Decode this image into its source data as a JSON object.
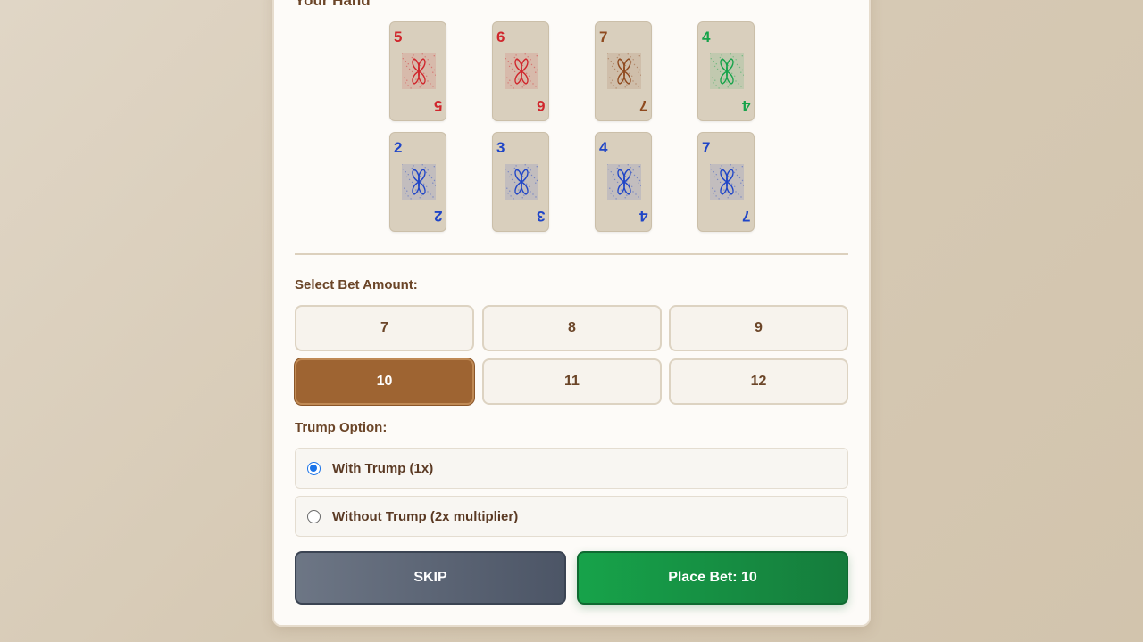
{
  "hand": {
    "title": "Your Hand",
    "cards": [
      {
        "rank": "5",
        "color": "#d0262c",
        "suit": "red"
      },
      {
        "rank": "6",
        "color": "#d0262c",
        "suit": "red"
      },
      {
        "rank": "7",
        "color": "#8f4a1f",
        "suit": "brown"
      },
      {
        "rank": "4",
        "color": "#16a34a",
        "suit": "green"
      },
      {
        "rank": "2",
        "color": "#1f45c7",
        "suit": "blue"
      },
      {
        "rank": "3",
        "color": "#1f45c7",
        "suit": "blue"
      },
      {
        "rank": "4",
        "color": "#1f45c7",
        "suit": "blue"
      },
      {
        "rank": "7",
        "color": "#1f45c7",
        "suit": "blue"
      }
    ]
  },
  "bet": {
    "label": "Select Bet Amount:",
    "options": [
      "7",
      "8",
      "9",
      "10",
      "11",
      "12"
    ],
    "selected": "10"
  },
  "trump": {
    "label": "Trump Option:",
    "options": [
      {
        "label": "With Trump (1x)",
        "checked": true
      },
      {
        "label": "Without Trump (2x multiplier)",
        "checked": false
      }
    ]
  },
  "actions": {
    "skip_label": "SKIP",
    "place_label": "Place Bet: 10"
  },
  "colors": {
    "accent": "#9e6432",
    "place": "#16a34a",
    "skip": "#4c5566"
  }
}
